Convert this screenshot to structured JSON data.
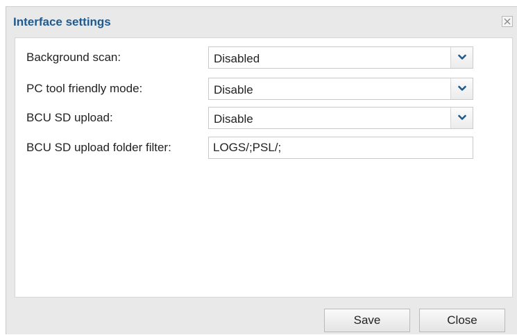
{
  "dialog": {
    "title": "Interface settings",
    "close_icon": "close-icon"
  },
  "fields": [
    {
      "label": "Background scan:",
      "value": "Disabled",
      "type": "select"
    },
    {
      "label": "PC tool friendly mode:",
      "value": "Disable",
      "type": "select"
    },
    {
      "label": "BCU SD upload:",
      "value": "Disable",
      "type": "select"
    },
    {
      "label": "BCU SD upload folder filter:",
      "value": "LOGS/;PSL/;",
      "type": "text"
    }
  ],
  "buttons": {
    "save_label": "Save",
    "close_label": "Close"
  },
  "colors": {
    "title": "#1f5a8f",
    "chevron": "#1f5a8f"
  }
}
